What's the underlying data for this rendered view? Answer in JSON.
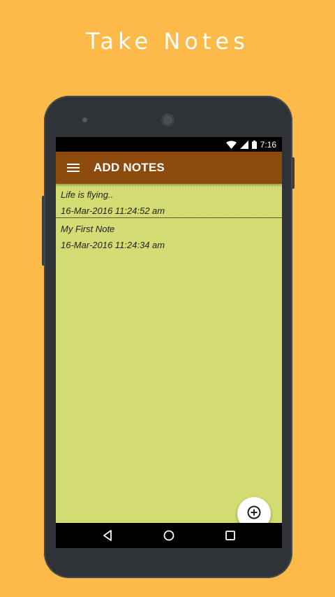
{
  "headline": "Take Notes",
  "status_bar": {
    "time": "7:16",
    "icons": [
      "wifi-icon",
      "signal-icon",
      "battery-icon"
    ]
  },
  "app_bar": {
    "title": "ADD NOTES",
    "menu_icon": "menu-icon"
  },
  "notes": [
    {
      "title": "Life is flying..",
      "date": "16-Mar-2016 11:24:52 am"
    },
    {
      "title": "My First Note",
      "date": "16-Mar-2016 11:24:34 am"
    }
  ],
  "fab": {
    "icon": "add-circle-icon"
  },
  "nav_bar": {
    "icons": [
      "back-icon",
      "home-icon",
      "recents-icon"
    ]
  },
  "colors": {
    "background": "#FDBA48",
    "app_bar": "#8C4A0C",
    "content": "#D4DD72",
    "phone_body": "#2F3337"
  }
}
